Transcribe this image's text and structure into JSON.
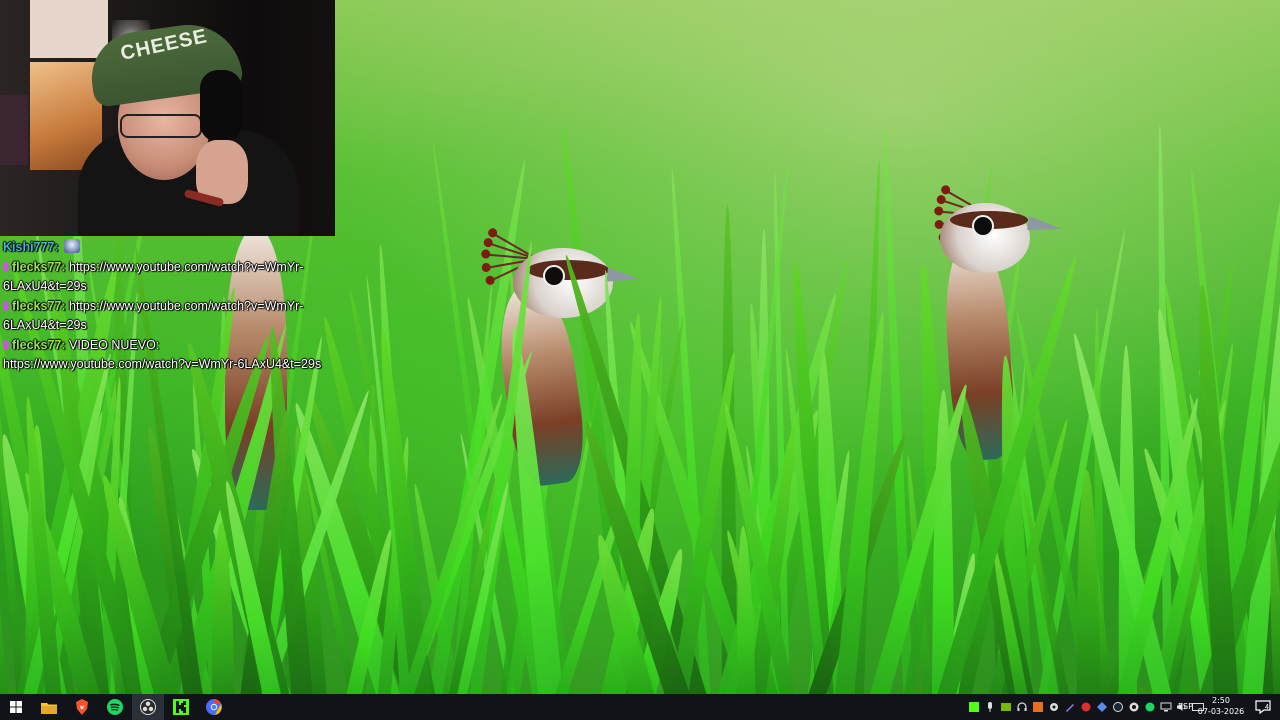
{
  "webcam": {
    "cap_text": "CHEESE"
  },
  "chat": {
    "messages": [
      {
        "user": "Kishi777:",
        "user_color": "#3fb6d6",
        "text": "",
        "emote": true,
        "badge": false
      },
      {
        "user": "flecks77:",
        "user_color": "#9ce05a",
        "text": " https://www.youtube.com/watch?v=WmYr-6LAxU4&t=29s",
        "emote": false,
        "badge": true
      },
      {
        "user": "flecks77:",
        "user_color": "#9ce05a",
        "text": " https://www.youtube.com/watch?v=WmYr-6LAxU4&t=29s",
        "emote": false,
        "badge": true
      },
      {
        "user": "flecks77:",
        "user_color": "#9ce05a",
        "text": " VIDEO NUEVO: https://www.youtube.com/watch?v=WmYr-6LAxU4&t=29s",
        "emote": false,
        "badge": true
      }
    ]
  },
  "taskbar": {
    "apps": [
      {
        "name": "windows-start",
        "icon": "windows-icon"
      },
      {
        "name": "file-explorer",
        "icon": "folder-icon"
      },
      {
        "name": "brave-browser",
        "icon": "brave-icon"
      },
      {
        "name": "spotify",
        "icon": "spotify-icon"
      },
      {
        "name": "obs-studio",
        "icon": "obs-icon",
        "active": true
      },
      {
        "name": "kick",
        "icon": "kick-icon"
      },
      {
        "name": "chrome-app",
        "icon": "chrome-icon"
      }
    ],
    "tray": {
      "language": "ESP",
      "time": "2:50",
      "date": "07-03-2026",
      "notifications_count": "4"
    }
  }
}
